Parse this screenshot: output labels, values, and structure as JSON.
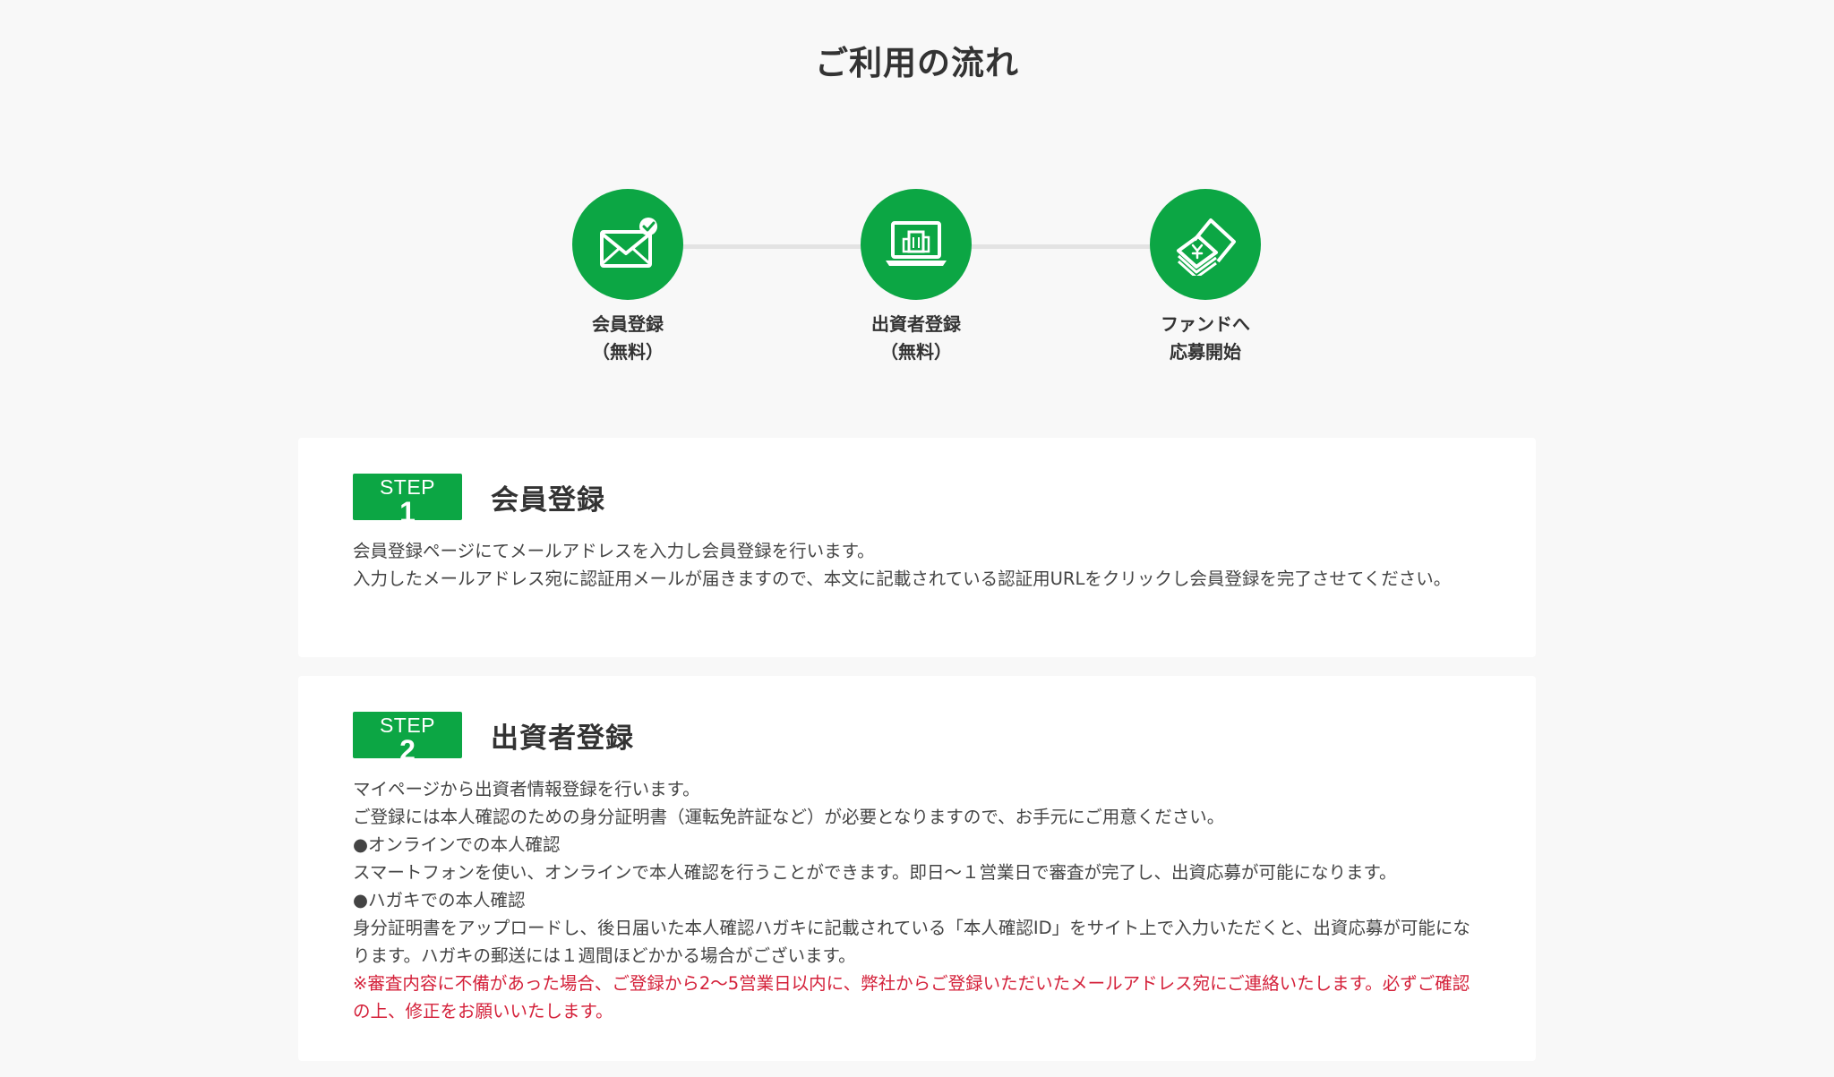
{
  "page": {
    "title": "ご利用の流れ"
  },
  "flow": {
    "steps": [
      {
        "icon": "mail-check-icon",
        "line1": "会員登録",
        "line2": "（無料）"
      },
      {
        "icon": "laptop-building-icon",
        "line1": "出資者登録",
        "line2": "（無料）"
      },
      {
        "icon": "yen-card-icon",
        "line1": "ファンドへ",
        "line2": "応募開始"
      }
    ]
  },
  "colors": {
    "accent": "#0ca644",
    "note": "#d4213a",
    "background": "#f8f8f8",
    "card": "#ffffff"
  },
  "step1": {
    "badge_word": "STEP",
    "badge_num": "1",
    "title": "会員登録",
    "paragraphs": [
      "会員登録ページにてメールアドレスを入力し会員登録を行います。",
      "入力したメールアドレス宛に認証用メールが届きますので、本文に記載されている認証用URLをクリックし会員登録を完了させてください。"
    ]
  },
  "step2": {
    "badge_word": "STEP",
    "badge_num": "2",
    "title": "出資者登録",
    "paragraphs": [
      "マイページから出資者情報登録を行います。",
      "ご登録には本人確認のための身分証明書（運転免許証など）が必要となりますので、お手元にご用意ください。",
      "●オンラインでの本人確認",
      "スマートフォンを使い、オンラインで本人確認を行うことができます。即日〜１営業日で審査が完了し、出資応募が可能になります。",
      "●ハガキでの本人確認",
      "身分証明書をアップロードし、後日届いた本人確認ハガキに記載されている「本人確認ID」をサイト上で入力いただくと、出資応募が可能になります。ハガキの郵送には１週間ほどかかる場合がございます。"
    ],
    "note": "※審査内容に不備があった場合、ご登録から2〜5営業日以内に、弊社からご登録いただいたメールアドレス宛にご連絡いたします。必ずご確認の上、修正をお願いいたします。"
  }
}
